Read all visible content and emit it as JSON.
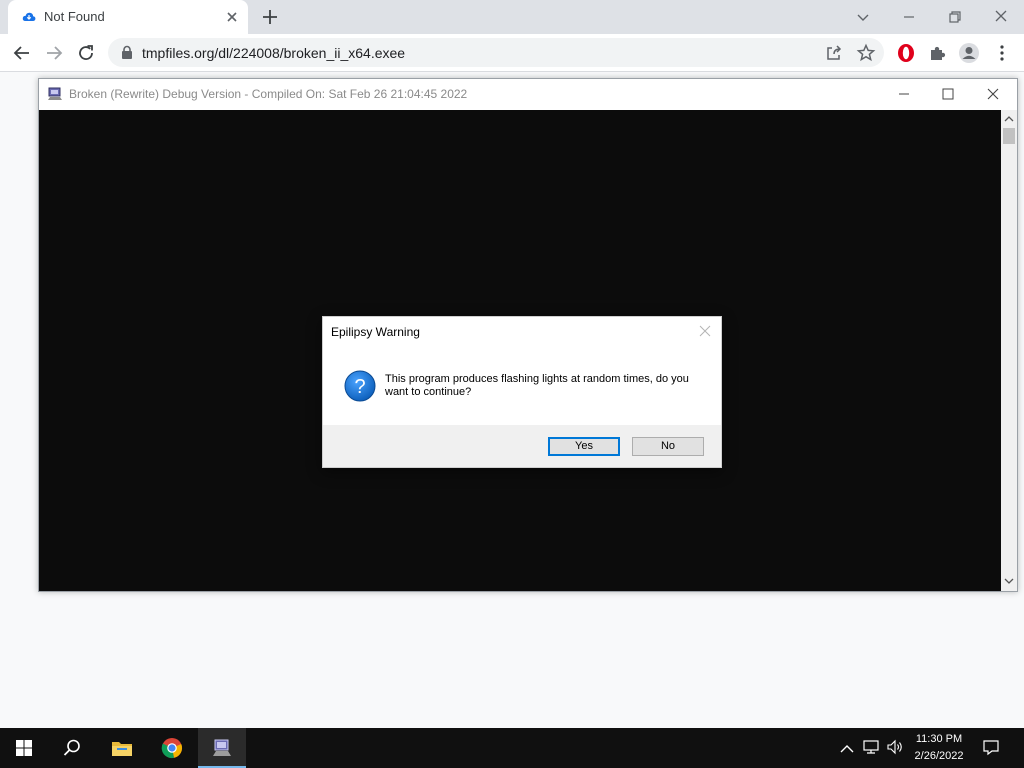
{
  "browser": {
    "tab": {
      "title": "Not Found"
    },
    "url": "tmpfiles.org/dl/224008/broken_ii_x64.exee",
    "accent": "#1a73e8"
  },
  "app_window": {
    "title": "Broken (Rewrite) Debug Version - Compiled On: Sat Feb 26 21:04:45 2022",
    "canvas_color": "#0c0c0c"
  },
  "dialog": {
    "title": "Epilipsy Warning",
    "icon": "question-icon",
    "message": "This program produces flashing lights at random times, do you want to continue?",
    "buttons": {
      "yes": "Yes",
      "no": "No"
    }
  },
  "taskbar": {
    "pinned": [
      "start-icon",
      "search-icon",
      "file-explorer-icon",
      "chrome-icon",
      "broken-app-icon"
    ],
    "clock": {
      "time": "11:30 PM",
      "date": "2/26/2022"
    }
  }
}
